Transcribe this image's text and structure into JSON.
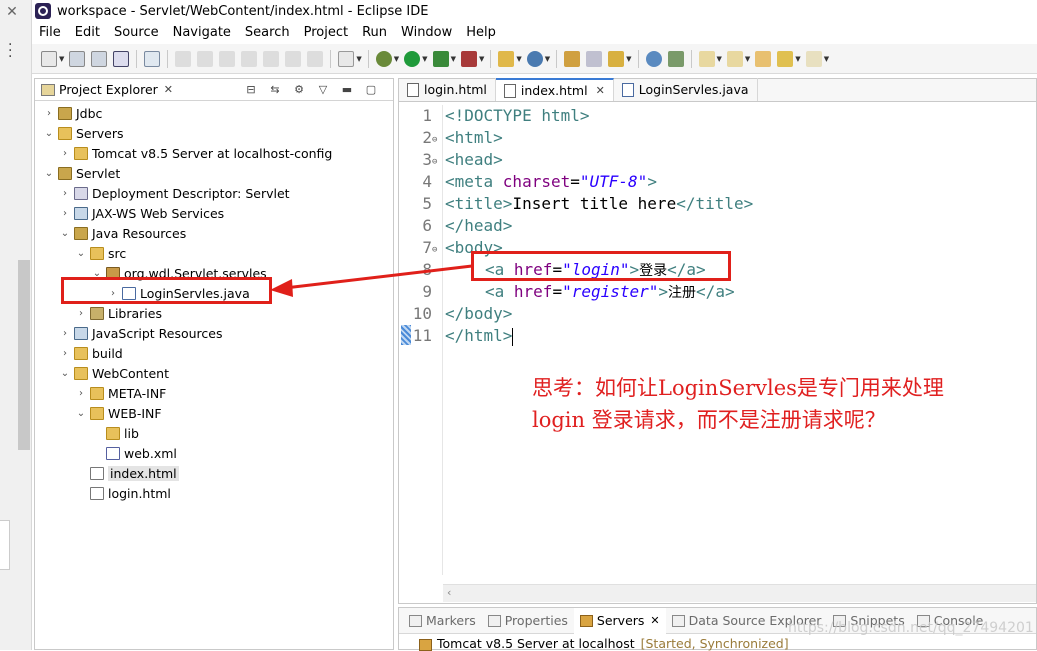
{
  "window": {
    "title": "workspace - Servlet/WebContent/index.html - Eclipse IDE"
  },
  "menubar": [
    "File",
    "Edit",
    "Source",
    "Navigate",
    "Search",
    "Project",
    "Run",
    "Window",
    "Help"
  ],
  "explorer": {
    "title": "Project Explorer",
    "tree": [
      {
        "label": "Jdbc",
        "icon": "project-icon",
        "depth": 0,
        "expanded": false
      },
      {
        "label": "Servers",
        "icon": "folder-icon",
        "depth": 0,
        "expanded": true
      },
      {
        "label": "Tomcat v8.5 Server at localhost-config",
        "icon": "folder-icon",
        "depth": 1,
        "expanded": false
      },
      {
        "label": "Servlet",
        "icon": "project-icon",
        "depth": 0,
        "expanded": true
      },
      {
        "label": "Deployment Descriptor: Servlet",
        "icon": "deployment-descriptor-icon",
        "depth": 1,
        "expanded": false
      },
      {
        "label": "JAX-WS Web Services",
        "icon": "web-services-icon",
        "depth": 1,
        "expanded": false
      },
      {
        "label": "Java Resources",
        "icon": "java-resources-icon",
        "depth": 1,
        "expanded": true
      },
      {
        "label": "src",
        "icon": "source-folder-icon",
        "depth": 2,
        "expanded": true
      },
      {
        "label": "org.wdl.Servlet.servles",
        "icon": "package-icon",
        "depth": 3,
        "expanded": true
      },
      {
        "label": "LoginServles.java",
        "icon": "java-file-icon",
        "depth": 4,
        "expanded": false
      },
      {
        "label": "Libraries",
        "icon": "libraries-icon",
        "depth": 2,
        "expanded": false
      },
      {
        "label": "JavaScript Resources",
        "icon": "javascript-resources-icon",
        "depth": 1,
        "expanded": false
      },
      {
        "label": "build",
        "icon": "folder-icon",
        "depth": 1,
        "expanded": false
      },
      {
        "label": "WebContent",
        "icon": "folder-icon",
        "depth": 1,
        "expanded": true
      },
      {
        "label": "META-INF",
        "icon": "folder-icon",
        "depth": 2,
        "expanded": false
      },
      {
        "label": "WEB-INF",
        "icon": "folder-icon",
        "depth": 2,
        "expanded": true
      },
      {
        "label": "lib",
        "icon": "folder-icon",
        "depth": 3,
        "leaf": true
      },
      {
        "label": "web.xml",
        "icon": "xml-file-icon",
        "depth": 3,
        "leaf": true
      },
      {
        "label": "index.html",
        "icon": "html-file-icon",
        "depth": 2,
        "leaf": true,
        "selected": true
      },
      {
        "label": "login.html",
        "icon": "html-file-icon",
        "depth": 2,
        "leaf": true
      }
    ]
  },
  "editor": {
    "tabs": [
      {
        "label": "login.html",
        "active": false
      },
      {
        "label": "index.html",
        "active": true,
        "close": "✕"
      },
      {
        "label": "LoginServles.java",
        "active": false
      }
    ],
    "line_numbers": [
      "1",
      "2",
      "3",
      "4",
      "5",
      "6",
      "7",
      "8",
      "9",
      "10",
      "11"
    ],
    "code": {
      "l1": "<!DOCTYPE html>",
      "l2": "<html>",
      "l3": "<head>",
      "l4_tag_open": "<meta ",
      "l4_attr": "charset",
      "l4_eq": "=",
      "l4_val": "\"UTF-8\"",
      "l4_close": ">",
      "l5_open": "<title>",
      "l5_text": "Insert title here",
      "l5_close": "</title>",
      "l6": "</head>",
      "l7": "<body>",
      "l8_open": "<a ",
      "l8_attr": "href",
      "l8_eq": "=",
      "l8_val": "\"login\"",
      "l8_gt": ">",
      "l8_text": "登录",
      "l8_close": "</a>",
      "l9_open": "<a ",
      "l9_attr": "href",
      "l9_eq": "=",
      "l9_val": "\"register\"",
      "l9_gt": ">",
      "l9_text": "注册",
      "l9_close": "</a>",
      "l10": "</body>",
      "l11": "</html>"
    }
  },
  "annotation": {
    "line1": "思考：如何让LoginServles是专门用来处理",
    "line2": "login 登录请求，而不是注册请求呢？"
  },
  "bottom_panel": {
    "tabs": [
      "Markers",
      "Properties",
      "Servers",
      "Data Source Explorer",
      "Snippets",
      "Console"
    ],
    "active_tab": "Servers",
    "server_name": "Tomcat v8.5 Server at localhost",
    "server_status": "[Started, Synchronized]"
  },
  "watermark": "https://blog.csdn.net/qq_27494201",
  "colors": {
    "annotation_red": "#e0201a",
    "tag": "#3f7f7f",
    "attr": "#7f007f",
    "value": "#2a00ff"
  }
}
